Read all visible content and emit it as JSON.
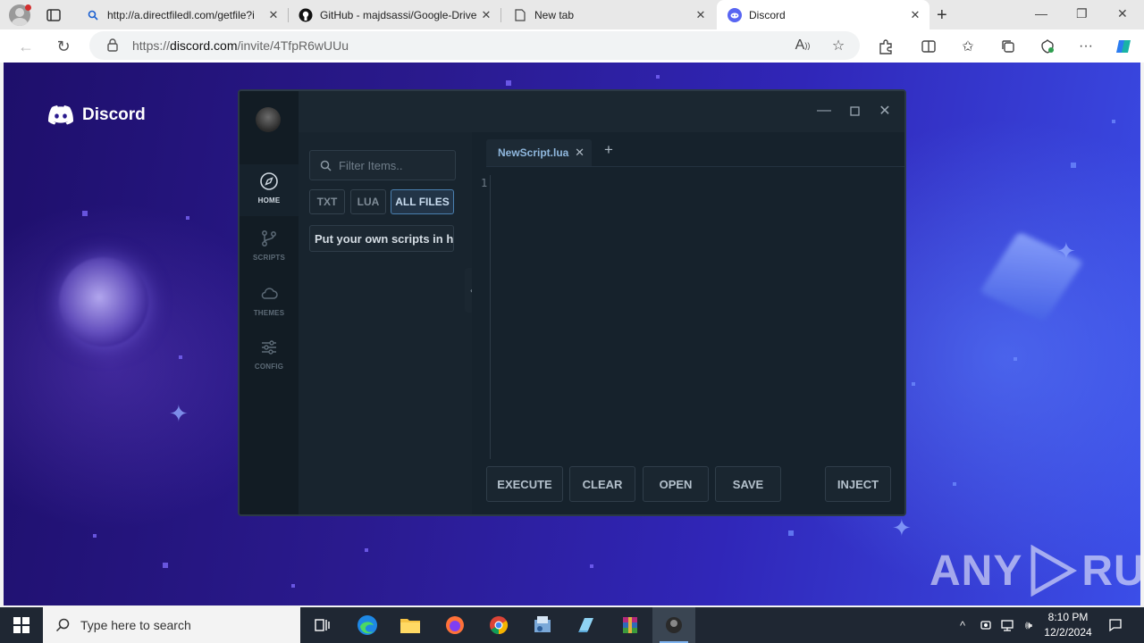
{
  "browser": {
    "tabs": [
      {
        "title": "http://a.directfiledl.com/getfile?i",
        "icon": "search-icon"
      },
      {
        "title": "GitHub - majdsassi/Google-Drive",
        "icon": "github-icon"
      },
      {
        "title": "New tab",
        "icon": "page-icon"
      },
      {
        "title": "Discord",
        "icon": "discord-icon",
        "active": true
      }
    ],
    "url_prefix": "https://",
    "url_host": "discord.com",
    "url_path": "/invite/4TfpR6wUUu"
  },
  "page": {
    "brand": "Discord"
  },
  "executor": {
    "nav": [
      {
        "label": "HOME",
        "icon": "compass-icon",
        "active": true
      },
      {
        "label": "SCRIPTS",
        "icon": "branch-icon"
      },
      {
        "label": "THEMES",
        "icon": "cloud-icon"
      },
      {
        "label": "CONFIG",
        "icon": "sliders-icon"
      }
    ],
    "filter_placeholder": "Filter Items..",
    "filters": [
      "TXT",
      "LUA",
      "ALL FILES"
    ],
    "active_filter": "ALL FILES",
    "file_item": "Put your own scripts in here",
    "editor_tab": "NewScript.lua",
    "line_number": "1",
    "actions": [
      "EXECUTE",
      "CLEAR",
      "OPEN",
      "SAVE",
      "INJECT"
    ]
  },
  "watermark": {
    "left": "ANY",
    "right": "RUN"
  },
  "taskbar": {
    "search_placeholder": "Type here to search",
    "time": "8:10 PM",
    "date": "12/2/2024"
  },
  "colors": {
    "accent": "#4a7fb0",
    "discord": "#5865f2"
  }
}
